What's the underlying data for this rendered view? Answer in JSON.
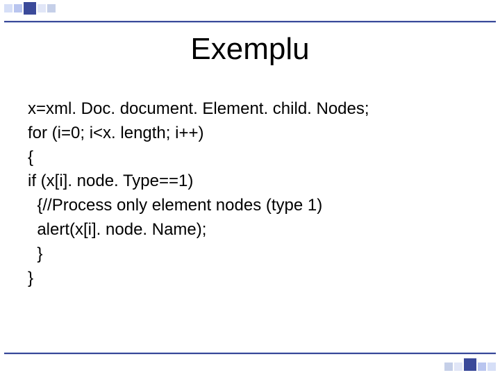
{
  "slide": {
    "title": "Exemplu",
    "code_lines": [
      "x=xml. Doc. document. Element. child. Nodes;",
      "for (i=0; i<x. length; i++)",
      "{",
      "if (x[i]. node. Type==1)",
      "  {//Process only element nodes (type 1)",
      "  alert(x[i]. node. Name);",
      "  }",
      "}"
    ]
  }
}
